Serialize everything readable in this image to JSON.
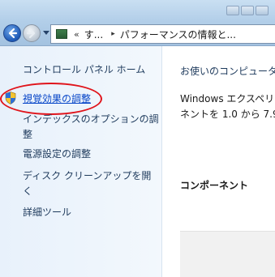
{
  "address_bar": {
    "overflow_chevron": "«",
    "crumb_1": "す...",
    "separator": "▸",
    "crumb_2": "パフォーマンスの情報と..."
  },
  "left_pane": {
    "home_link": "コントロール パネル ホーム",
    "visual_effects_link": "視覚効果の調整",
    "indexing_link": "インデックスのオプションの調整",
    "power_link": "電源設定の調整",
    "disk_cleanup_link": "ディスク クリーンアップを開く",
    "advanced_tools_link": "詳細ツール"
  },
  "content": {
    "intro": "お使いのコンピュータ",
    "body_line1": "Windows エクスペリ",
    "body_line2": "ネントを 1.0 から 7.9",
    "component_header": "コンポーネント"
  },
  "colors": {
    "link": "#0645c8",
    "highlight": "#e0141b",
    "pane_bg": "#eef5fc"
  },
  "icons": {
    "back": "back-arrow-icon",
    "forward": "forward-arrow-icon",
    "address": "performance-icon",
    "shield": "uac-shield-icon"
  }
}
